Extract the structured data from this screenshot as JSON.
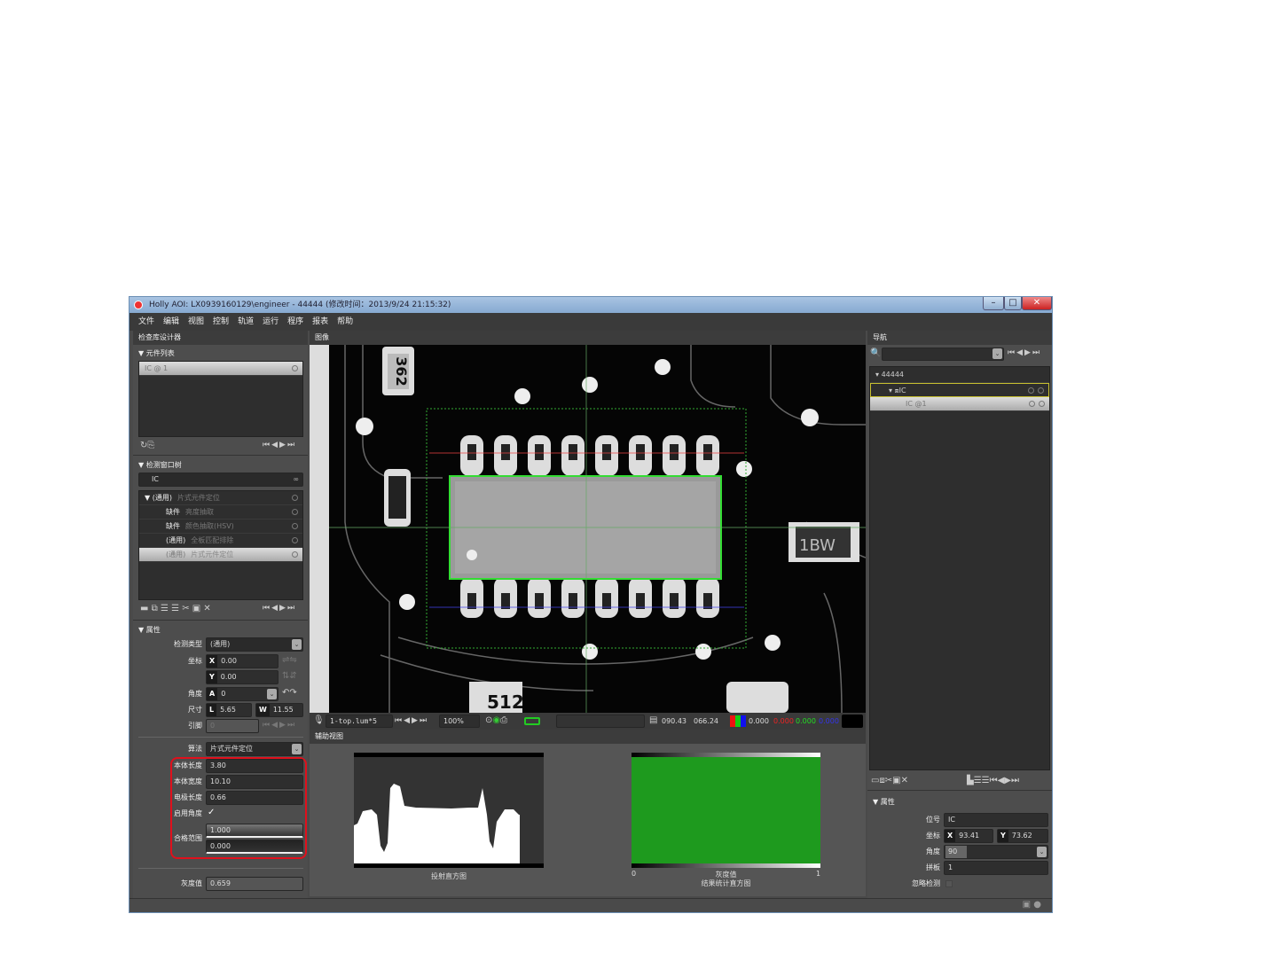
{
  "window": {
    "title": "Holly AOI: LX0939160129\\engineer - 44444 (修改时间：2013/9/24 21:15:32)",
    "min": "–",
    "max": "□",
    "close": "✕"
  },
  "menu": [
    "文件",
    "编辑",
    "视图",
    "控制",
    "轨道",
    "运行",
    "程序",
    "报表",
    "帮助"
  ],
  "left": {
    "header": "检查库设计器",
    "component_list": {
      "title": "▼ 元件列表",
      "items": [
        "IC  @ 1"
      ]
    },
    "window_tree": {
      "title": "▼ 检测窗口树",
      "selected": "IC",
      "items": [
        {
          "tag": "▼ (通用)",
          "name": "片式元件定位"
        },
        {
          "tag": "缺件",
          "name": "亮度抽取"
        },
        {
          "tag": "缺件",
          "name": "颜色抽取(HSV)"
        },
        {
          "tag": "(通用)",
          "name": "全板匹配排除"
        },
        {
          "tag": "(通用)",
          "name": "片式元件定位"
        }
      ]
    },
    "props": {
      "title": "▼ 属性",
      "type_label": "检测类型",
      "type_value": "(通用)",
      "coord_label": "坐标",
      "x": "0.00",
      "y": "0.00",
      "angle_label": "角度",
      "angle": "0",
      "size_label": "尺寸",
      "l": "5.65",
      "w": "11.55",
      "pin_label": "引脚",
      "pin": "0",
      "algo_label": "算法",
      "algo": "片式元件定位",
      "body_len_label": "本体长度",
      "body_len": "3.80",
      "body_wid_label": "本体宽度",
      "body_wid": "10.10",
      "elec_len_label": "电极长度",
      "elec_len": "0.66",
      "enable_angle_label": "启用角度",
      "enable_angle": "✓",
      "range_label": "合格范围",
      "range_max": "1.000",
      "range_min": "0.000",
      "gray_label": "灰度值",
      "gray": "0.659"
    }
  },
  "image": {
    "header": "图像",
    "chip_labels": [
      "362",
      "1BW",
      "512"
    ],
    "toolbar": {
      "layer": "1-top.lum*5",
      "zoom": "100%",
      "x": "090.43",
      "y": "066.24",
      "gray": "0.000",
      "r": "0.000",
      "g": "0.000",
      "b": "0.000"
    }
  },
  "aux": {
    "header": "辅助视图",
    "proj_title": "投射直方图",
    "result_xlabel": "灰度值",
    "result_title": "结果统计直方图",
    "x_min": "0",
    "x_max": "1"
  },
  "nav": {
    "header": "导航",
    "root": "44444",
    "node": "IC",
    "child": "IC @1"
  },
  "right_props": {
    "title": "▼ 属性",
    "ref_label": "位号",
    "ref": "IC",
    "coord_label": "坐标",
    "x": "93.41",
    "y": "73.62",
    "angle_label": "角度",
    "angle": "90",
    "panel_label": "拼板",
    "panel": "1",
    "ignore_label": "忽略检测"
  },
  "colors": {
    "accent_green": "#1e9a1e",
    "highlight_red": "#e0101c",
    "nav_select": "#c8c030"
  }
}
